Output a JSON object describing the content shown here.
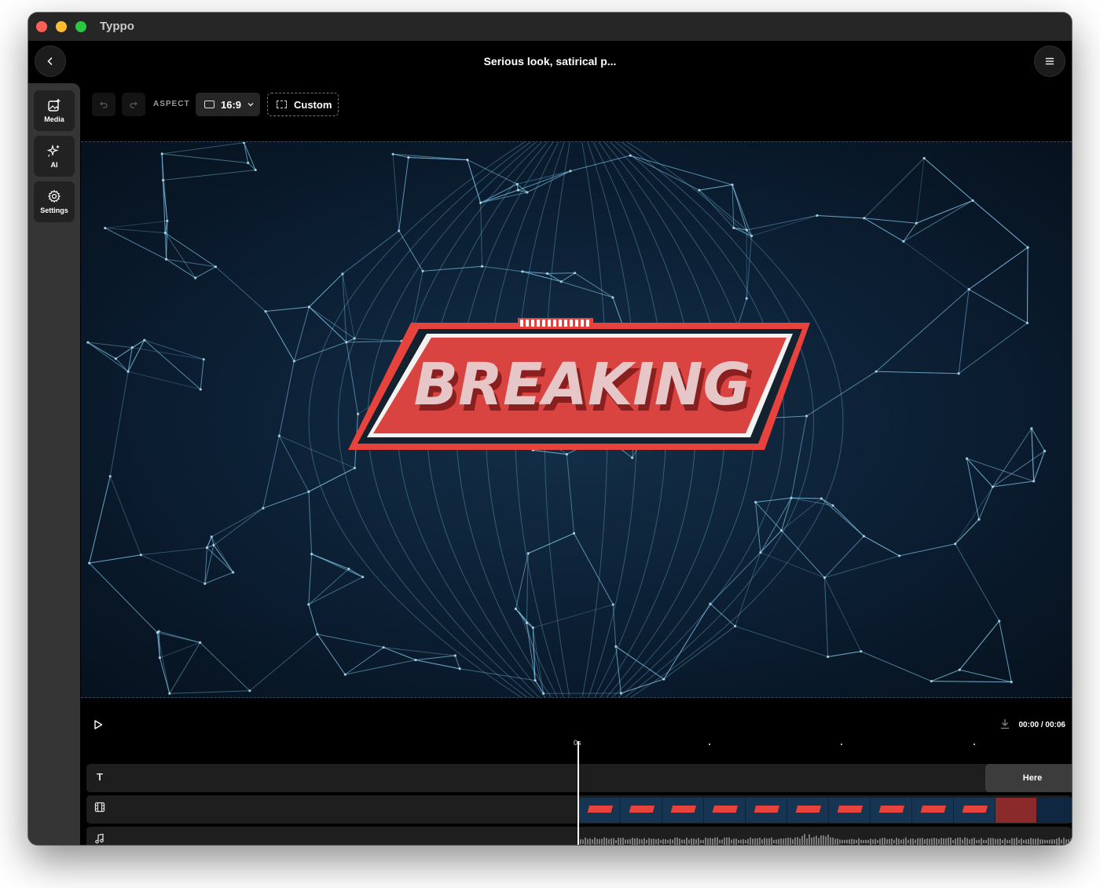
{
  "app": {
    "title": "Typpo"
  },
  "header": {
    "project_title": "Serious look, satirical p..."
  },
  "sidebar": {
    "items": [
      {
        "label": "Media",
        "icon": "media-add-icon"
      },
      {
        "label": "AI",
        "icon": "sparkle-icon"
      },
      {
        "label": "Settings",
        "icon": "gear-icon"
      }
    ]
  },
  "toolbar": {
    "aspect_label": "ASPECT",
    "ratio_value": "16:9",
    "custom_label": "Custom"
  },
  "canvas": {
    "overlay_text": "BREAKING"
  },
  "player": {
    "time_display": "00:00 / 00:06",
    "ruler_zero": "0s"
  },
  "timeline": {
    "text_clip_label": "Here"
  },
  "colors": {
    "accent_red": "#e8423c",
    "canvas_bg": "#0b1e32",
    "network_line": "#7fc4e6"
  }
}
